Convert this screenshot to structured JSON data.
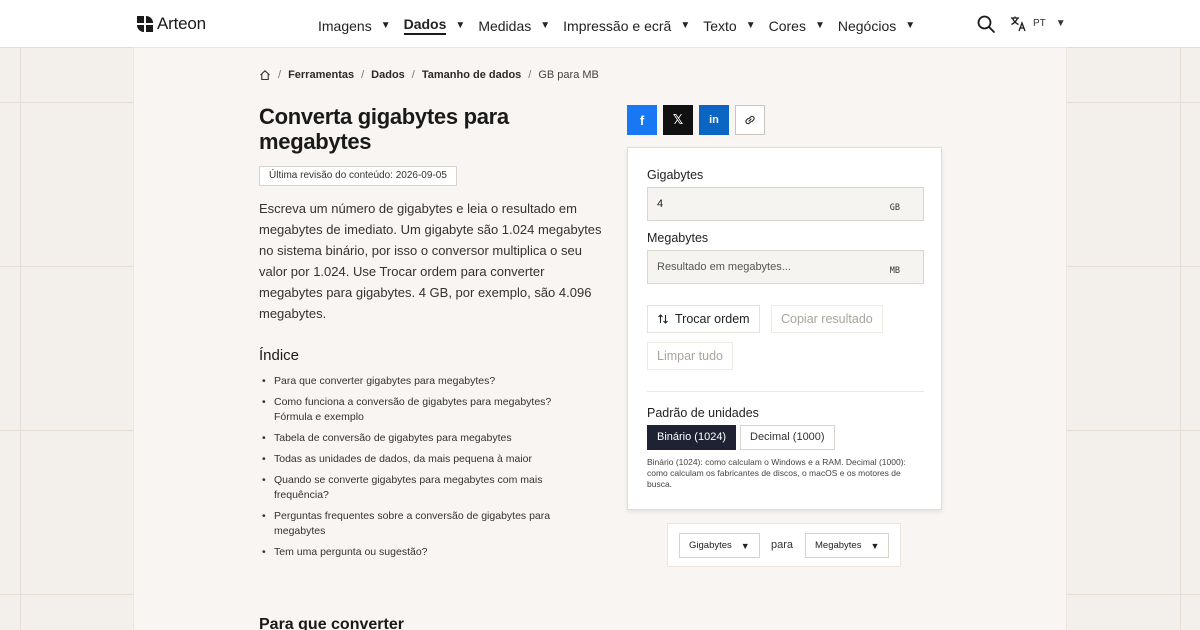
{
  "brand": {
    "name": "Arteon"
  },
  "nav": {
    "items": [
      {
        "label": "Imagens",
        "active": false
      },
      {
        "label": "Dados",
        "active": true
      },
      {
        "label": "Medidas",
        "active": false
      },
      {
        "label": "Impressão e ecrã",
        "active": false
      },
      {
        "label": "Texto",
        "active": false
      },
      {
        "label": "Cores",
        "active": false
      },
      {
        "label": "Negócios",
        "active": false
      }
    ],
    "language": "PT"
  },
  "breadcrumb": {
    "items": [
      "Ferramentas",
      "Dados",
      "Tamanho de dados"
    ],
    "current": "GB para MB"
  },
  "article": {
    "title": "Converta gigabytes para megabytes",
    "revision": "Última revisão do conteúdo: 2026-09-05",
    "intro": "Escreva um número de gigabytes e leia o resultado em megabytes de imediato. Um gigabyte são 1.024 megabytes no sistema binário, por isso o conversor multiplica o seu valor por 1.024. Use Trocar ordem para converter megabytes para gigabytes. 4 GB, por exemplo, são 4.096 megabytes.",
    "toc_title": "Índice",
    "toc": [
      "Para que converter gigabytes para megabytes?",
      "Como funciona a conversão de gigabytes para megabytes? Fórmula e exemplo",
      "Tabela de conversão de gigabytes para megabytes",
      "Todas as unidades de dados, da mais pequena à maior",
      "Quando se converte gigabytes para megabytes com mais frequência?",
      "Perguntas frequentes sobre a conversão de gigabytes para megabytes",
      "Tem uma pergunta ou sugestão?"
    ],
    "next_section": "Para que converter"
  },
  "share": {
    "facebook": "f",
    "x": "𝕏",
    "linkedin": "in"
  },
  "converter": {
    "input_label": "Gigabytes",
    "input_value": "4",
    "input_unit": "GB",
    "output_label": "Megabytes",
    "output_placeholder": "Resultado em megabytes...",
    "output_unit": "MB",
    "swap_label": "Trocar ordem",
    "copy_label": "Copiar resultado",
    "clear_label": "Limpar tudo",
    "standard_label": "Padrão de unidades",
    "binary_label": "Binário (1024)",
    "decimal_label": "Decimal (1000)",
    "standard_note": "Binário (1024): como calculam o Windows e a RAM. Decimal (1000): como calculam os fabricantes de discos, o macOS e os motores de busca."
  },
  "chooser": {
    "from": "Gigabytes",
    "connector": "para",
    "to": "Megabytes"
  },
  "colors": {
    "accent_dark": "#1e2233",
    "facebook": "#1877f2",
    "linkedin": "#0a66c2"
  }
}
